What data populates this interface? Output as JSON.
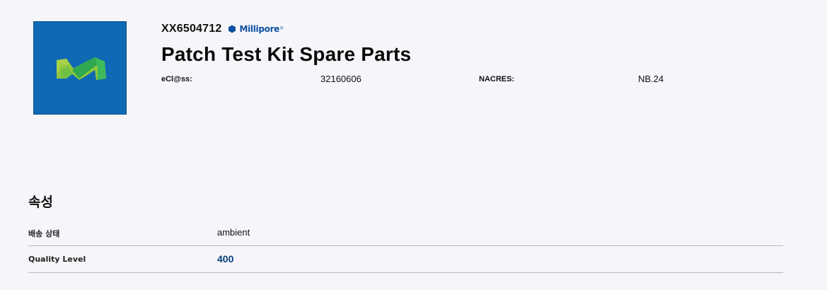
{
  "product": {
    "sku": "XX6504712",
    "brand": "Millipore",
    "brand_mark": "®",
    "brand_icon": "hexagon-icon",
    "brand_color": "#0f4fa0",
    "title": "Patch Test Kit Spare Parts",
    "image_icon": "merck-m-logo",
    "image_bg": "#0f69b4"
  },
  "meta": {
    "eclass_label": "eCl@ss:",
    "eclass_value": "32160606",
    "nacres_label": "NACRES:",
    "nacres_value": "NB.24"
  },
  "properties": {
    "title": "속성",
    "rows": [
      {
        "label": "배송 상태",
        "value": "ambient"
      },
      {
        "label": "Quality Level",
        "value": "400"
      }
    ]
  }
}
